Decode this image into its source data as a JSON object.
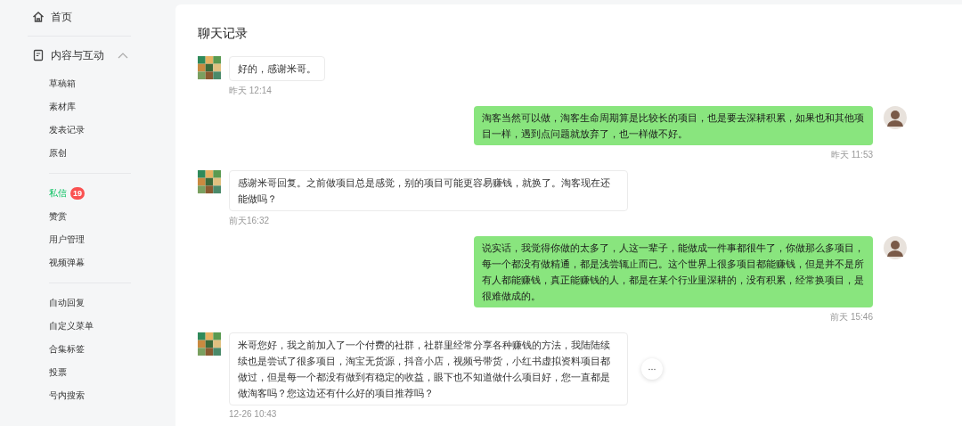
{
  "sidebar": {
    "items": [
      {
        "label": "首页",
        "kind": "home"
      },
      {
        "label": "内容与互动",
        "kind": "group",
        "expanded": true,
        "sections": [
          {
            "items": [
              {
                "label": "草稿箱",
                "selected": false
              },
              {
                "label": "素材库",
                "selected": false
              },
              {
                "label": "发表记录",
                "selected": false
              },
              {
                "label": "原创",
                "selected": false
              }
            ]
          },
          {
            "items": [
              {
                "label": "私信",
                "selected": true,
                "badge": "19"
              },
              {
                "label": "赞赏",
                "selected": false
              },
              {
                "label": "用户管理",
                "selected": false
              },
              {
                "label": "视频弹幕",
                "selected": false
              }
            ]
          },
          {
            "items": [
              {
                "label": "自动回复",
                "selected": false
              },
              {
                "label": "自定义菜单",
                "selected": false
              },
              {
                "label": "合集标签",
                "selected": false
              },
              {
                "label": "投票",
                "selected": false
              },
              {
                "label": "号内搜索",
                "selected": false
              }
            ]
          }
        ]
      }
    ]
  },
  "chat": {
    "title": "聊天记录",
    "messages": [
      {
        "kind": "incoming",
        "text": "好的，感谢米哥。",
        "time": "昨天 12:14"
      },
      {
        "kind": "outgoing",
        "text": "淘客当然可以做，淘客生命周期算是比较长的项目，也是要去深耕积累，如果也和其他项目一样，遇到点问题就放弃了，也一样做不好。",
        "time": "昨天 11:53"
      },
      {
        "kind": "incoming",
        "text": "感谢米哥回复。之前做项目总是感觉，别的项目可能更容易赚钱，就换了。淘客现在还能做吗？",
        "time": "前天16:32"
      },
      {
        "kind": "outgoing",
        "text": "说实话，我觉得你做的太多了，人这一辈子，能做成一件事都很牛了，你做那么多项目，每一个都没有做精通，都是浅尝辄止而已。这个世界上很多项目都能赚钱，但是并不是所有人都能赚钱，真正能赚钱的人，都是在某个行业里深耕的，没有积累，经常换项目，是很难做成的。",
        "time": "前天 15:46"
      },
      {
        "kind": "incoming",
        "text": "米哥您好，我之前加入了一个付费的社群，社群里经常分享各种赚钱的方法，我陆陆续续也是尝试了很多项目，淘宝无货源，抖音小店，视频号带货，小红书虚拟资料项目都做过，但是每一个都没有做到有稳定的收益，眼下也不知道做什么项目好，您一直都是做淘客吗？您这边还有什么好的项目推荐吗？",
        "time": "12-26 10:43",
        "more_button": true
      }
    ]
  }
}
